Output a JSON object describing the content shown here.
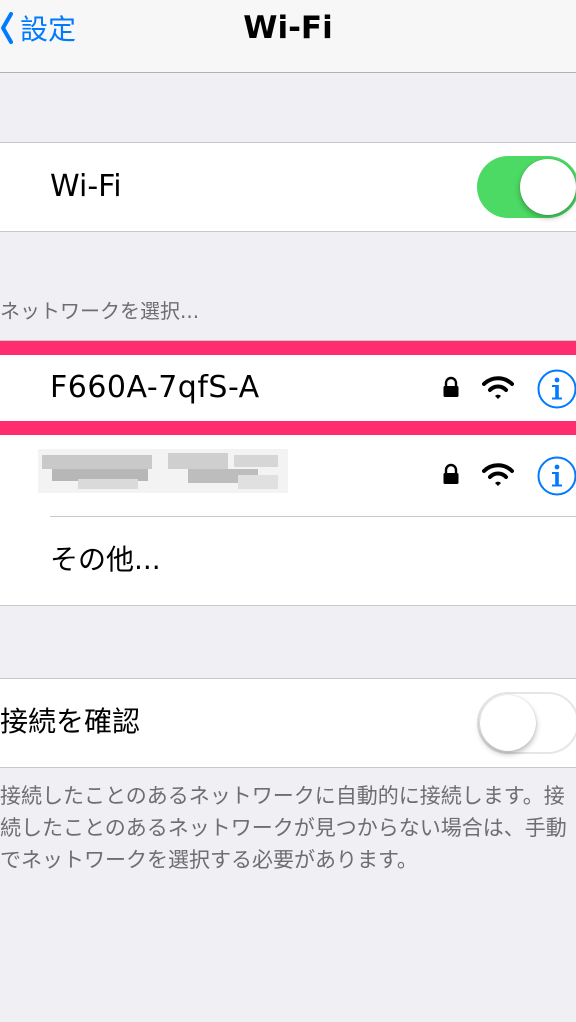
{
  "nav": {
    "back_label": "設定",
    "title": "Wi-Fi"
  },
  "wifi": {
    "label": "Wi-Fi",
    "enabled": true
  },
  "networks_header": "ネットワークを選択...",
  "networks": [
    {
      "ssid": "F660A-7qfS-A",
      "secured": true,
      "highlighted": true
    },
    {
      "ssid": "",
      "secured": true,
      "blurred": true
    }
  ],
  "other_label": "その他...",
  "ask_to_join": {
    "label": "接続を確認",
    "enabled": false
  },
  "footer": "接続したことのあるネットワークに自動的に接続します。接続したことのあるネットワークが見つからない場合は、手動でネットワークを選択する必要があります。",
  "colors": {
    "accent": "#007aff",
    "toggle_on": "#4cd964",
    "highlight": "#ff2d6f"
  },
  "icons": [
    "chevron-left-icon",
    "lock-icon",
    "wifi-signal-icon",
    "info-icon"
  ]
}
